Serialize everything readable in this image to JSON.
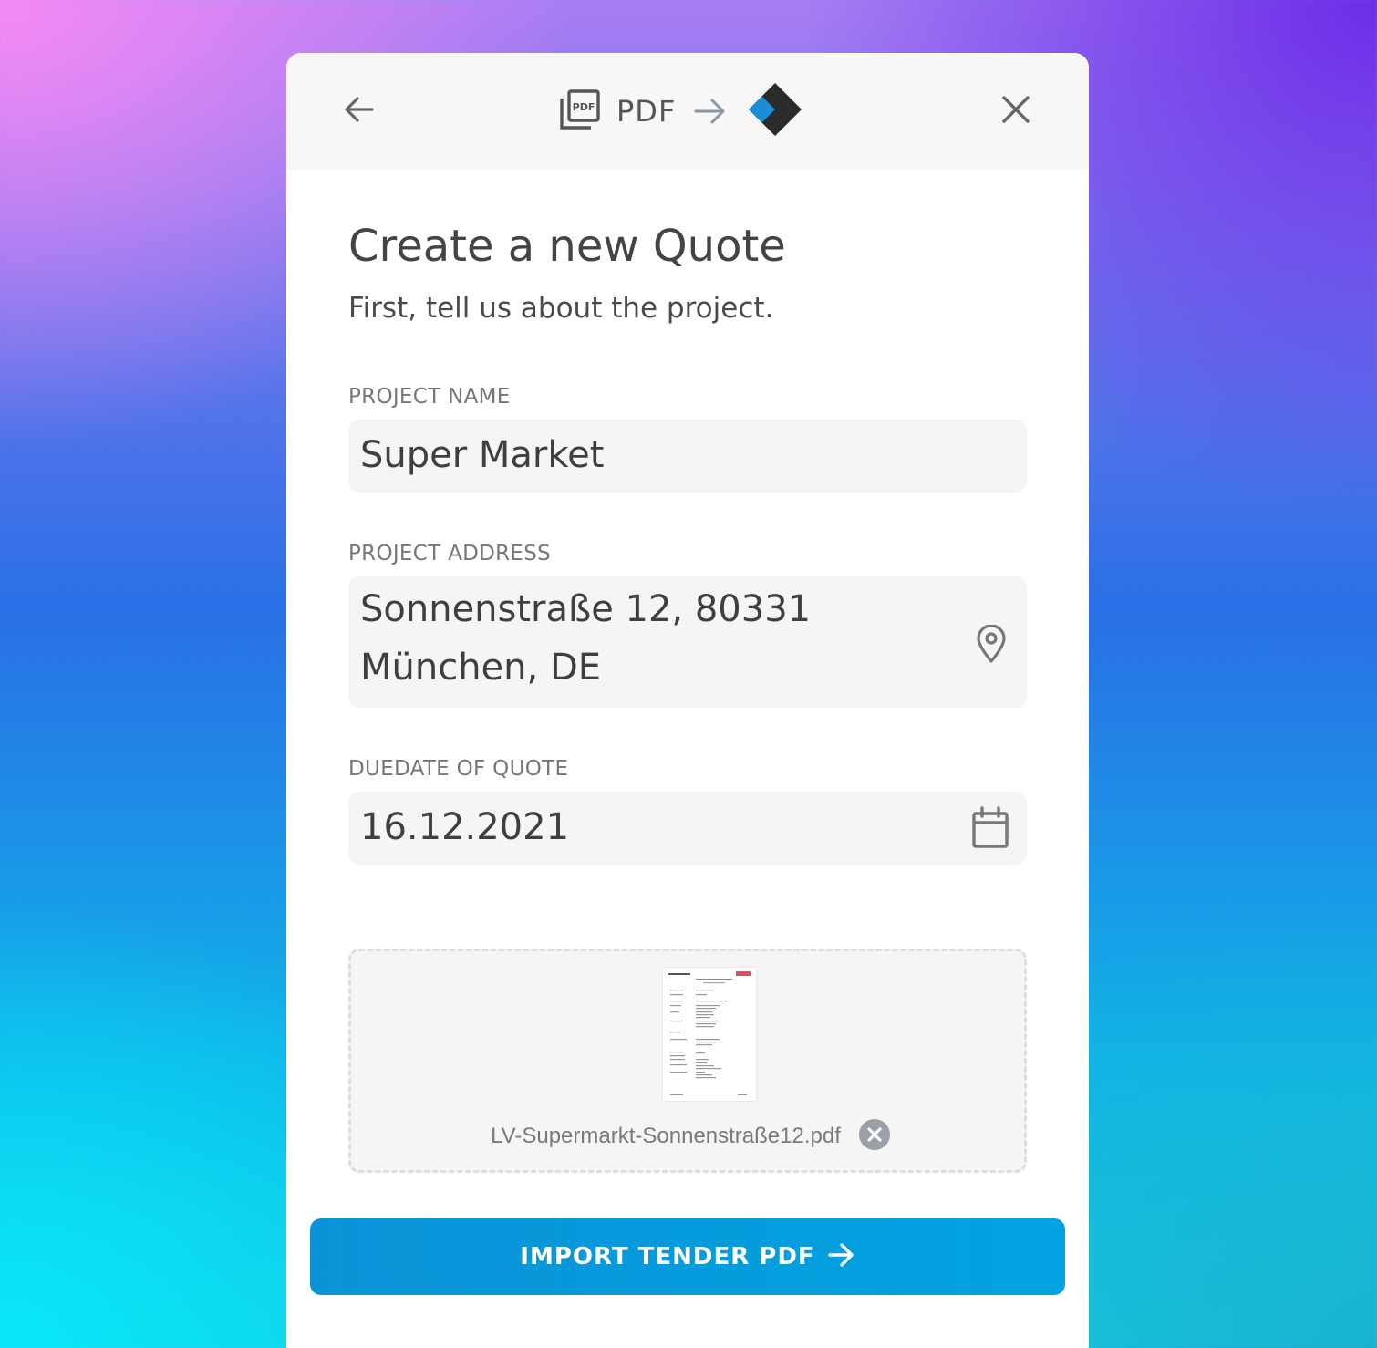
{
  "header": {
    "source_label": "PDF",
    "source_icon": "pdf-stack-icon",
    "target_icon": "app-logo-diamond-icon",
    "back_icon": "arrow-left-icon",
    "close_icon": "close-icon"
  },
  "form": {
    "title": "Create a new Quote",
    "subtitle": "First, tell us about the project.",
    "project_name": {
      "label": "PROJECT NAME",
      "value": "Super Market"
    },
    "project_address": {
      "label": "PROJECT ADDRESS",
      "value_line1": "Sonnenstraße 12, 80331",
      "value_line2": "München, DE",
      "icon": "map-pin-icon"
    },
    "due_date": {
      "label": "DUEDATE OF QUOTE",
      "value": "16.12.2021",
      "icon": "calendar-icon"
    }
  },
  "upload": {
    "file_name": "LV-Supermarkt-Sonnenstraße12.pdf",
    "remove_icon": "remove-circle-icon"
  },
  "actions": {
    "import_label": "IMPORT TENDER PDF",
    "import_icon": "arrow-right-icon"
  },
  "colors": {
    "primary": "#00a3e0",
    "logo_blue": "#1a8fd8",
    "logo_dark": "#2b2b2b"
  }
}
